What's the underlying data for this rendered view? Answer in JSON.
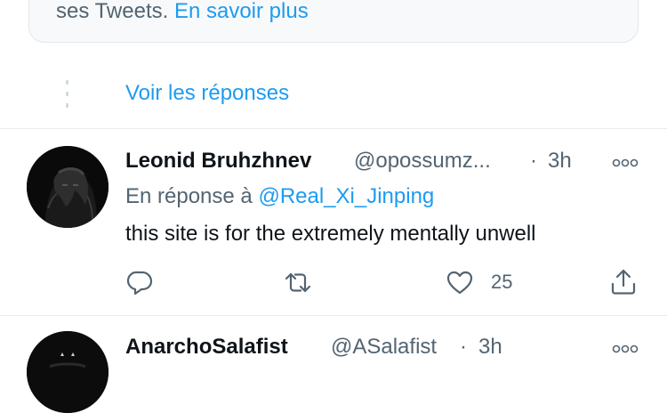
{
  "notice": {
    "text": "ses Tweets.",
    "link": "En savoir plus"
  },
  "thread": {
    "show_replies": "Voir les réponses"
  },
  "tweets": [
    {
      "name": "Leonid Bruhzhnev",
      "handle": "@opossumz...",
      "separator": "·",
      "time": "3h",
      "reply_prefix": "En réponse à",
      "reply_handle": "@Real_Xi_Jinping",
      "text": "this site is for the extremely mentally unwell",
      "like_count": "25"
    },
    {
      "name": "AnarchoSalafist",
      "handle": "@ASalafist",
      "separator": "·",
      "time": "3h"
    }
  ],
  "icons": {
    "more": "more-options-icon",
    "reply": "reply-icon",
    "retweet": "retweet-icon",
    "like": "like-icon",
    "share": "share-icon"
  },
  "colors": {
    "link": "#1d9bf0",
    "secondary_text": "#536471",
    "primary_text": "#0f1419",
    "divider": "#e6ecf0"
  }
}
